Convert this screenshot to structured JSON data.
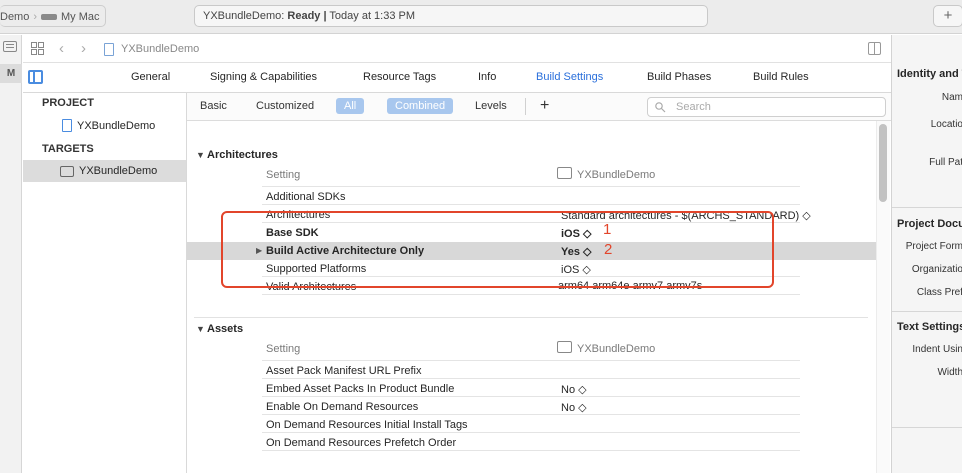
{
  "toolbar": {
    "scheme_target": "Demo",
    "scheme_device": "My Mac",
    "status_app": "YXBundleDemo:",
    "status_state": "Ready",
    "status_separator": "|",
    "status_time": "Today at 1:33 PM",
    "add_label": "+"
  },
  "leftbar": {
    "m_label": "M"
  },
  "jumpbar": {
    "crumb": "YXBundleDemo"
  },
  "tabs": [
    "General",
    "Signing & Capabilities",
    "Resource Tags",
    "Info",
    "Build Settings",
    "Build Phases",
    "Build Rules"
  ],
  "active_tab": "Build Settings",
  "sidebar": {
    "project_header": "PROJECT",
    "project_item": "YXBundleDemo",
    "targets_header": "TARGETS",
    "target_item": "YXBundleDemo"
  },
  "filters": {
    "basic": "Basic",
    "customized": "Customized",
    "all": "All",
    "combined": "Combined",
    "levels": "Levels",
    "add": "+",
    "search_placeholder": "Search"
  },
  "architectures": {
    "title": "Architectures",
    "col_setting": "Setting",
    "col_target": "YXBundleDemo",
    "rows": [
      {
        "name": "Additional SDKs",
        "value": ""
      },
      {
        "name": "Architectures",
        "value": "Standard architectures  -  $(ARCHS_STANDARD) ◇"
      },
      {
        "name": "Base SDK",
        "value": "iOS ◇"
      },
      {
        "name": "Build Active Architecture Only",
        "value": "Yes ◇"
      },
      {
        "name": "Supported Platforms",
        "value": "iOS ◇"
      },
      {
        "name": "Valid Architectures",
        "value": "arm64 arm64e armv7 armv7s"
      }
    ]
  },
  "annotations": {
    "one": "1",
    "two": "2"
  },
  "assets": {
    "title": "Assets",
    "col_setting": "Setting",
    "col_target": "YXBundleDemo",
    "rows": [
      {
        "name": "Asset Pack Manifest URL Prefix",
        "value": ""
      },
      {
        "name": "Embed Asset Packs In Product Bundle",
        "value": "No ◇"
      },
      {
        "name": "Enable On Demand Resources",
        "value": "No ◇"
      },
      {
        "name": "On Demand Resources Initial Install Tags",
        "value": ""
      },
      {
        "name": "On Demand Resources Prefetch Order",
        "value": ""
      }
    ]
  },
  "inspector": {
    "identity_title": "Identity and T",
    "name_label": "Nam",
    "location_label": "Locatio",
    "fullpath_label": "Full Pat",
    "project_doc_title": "Project Docu",
    "project_format_label": "Project Form",
    "organization_label": "Organizatio",
    "class_prefix_label": "Class Pref",
    "text_settings_title": "Text Settings",
    "indent_label": "Indent Usin",
    "width_label": "Width"
  },
  "colors": {
    "accent": "#2a6fdb",
    "annotation": "#e2452b",
    "pill": "#a8c7ee",
    "selection": "#d8d8d8"
  }
}
